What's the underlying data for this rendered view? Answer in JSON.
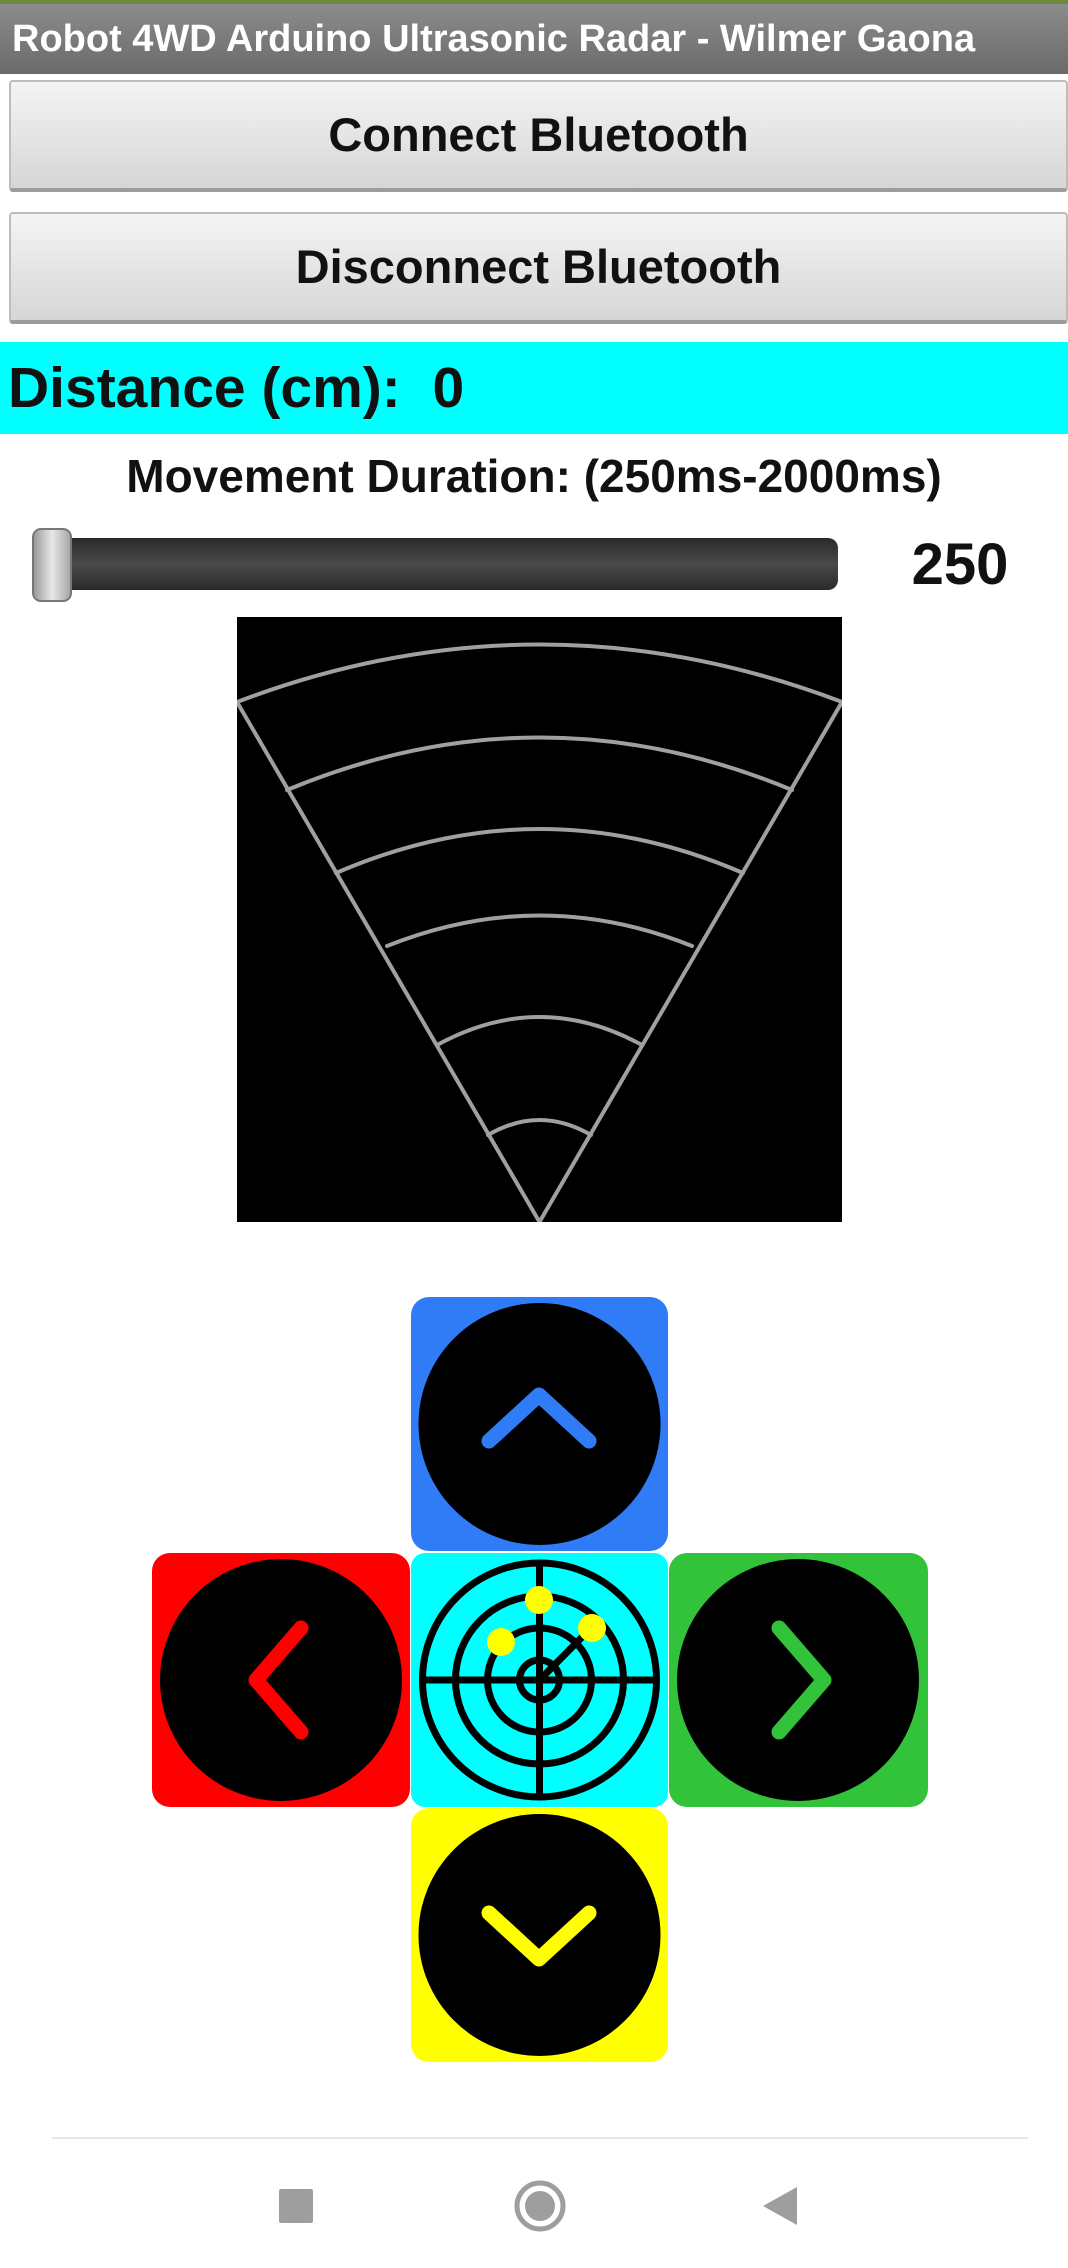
{
  "app": {
    "title": "Robot 4WD Arduino Ultrasonic Radar - Wilmer Gaona"
  },
  "buttons": {
    "connect_label": "Connect Bluetooth",
    "disconnect_label": "Disconnect Bluetooth"
  },
  "distance": {
    "label": "Distance (cm):",
    "value": "0"
  },
  "movement": {
    "label": "Movement Duration: (250ms-2000ms)",
    "slider_min": 250,
    "slider_max": 2000,
    "slider_value": 250,
    "value_text": "250"
  },
  "radar": {
    "background": "#000000",
    "line_color": "#a0a0a0",
    "arc_count": 6
  },
  "controls": {
    "up": {
      "icon": "chevron-up-icon",
      "color": "#2f7cf6"
    },
    "left": {
      "icon": "chevron-left-icon",
      "color": "#ff0000"
    },
    "center": {
      "icon": "radar-icon",
      "color": "#00ffff",
      "blip_color": "#ffff00"
    },
    "right": {
      "icon": "chevron-right-icon",
      "color": "#33c33b"
    },
    "down": {
      "icon": "chevron-down-icon",
      "color": "#ffff00"
    }
  },
  "navbar": {
    "icons": [
      "square-recent-icon",
      "circle-home-icon",
      "triangle-back-icon"
    ]
  }
}
